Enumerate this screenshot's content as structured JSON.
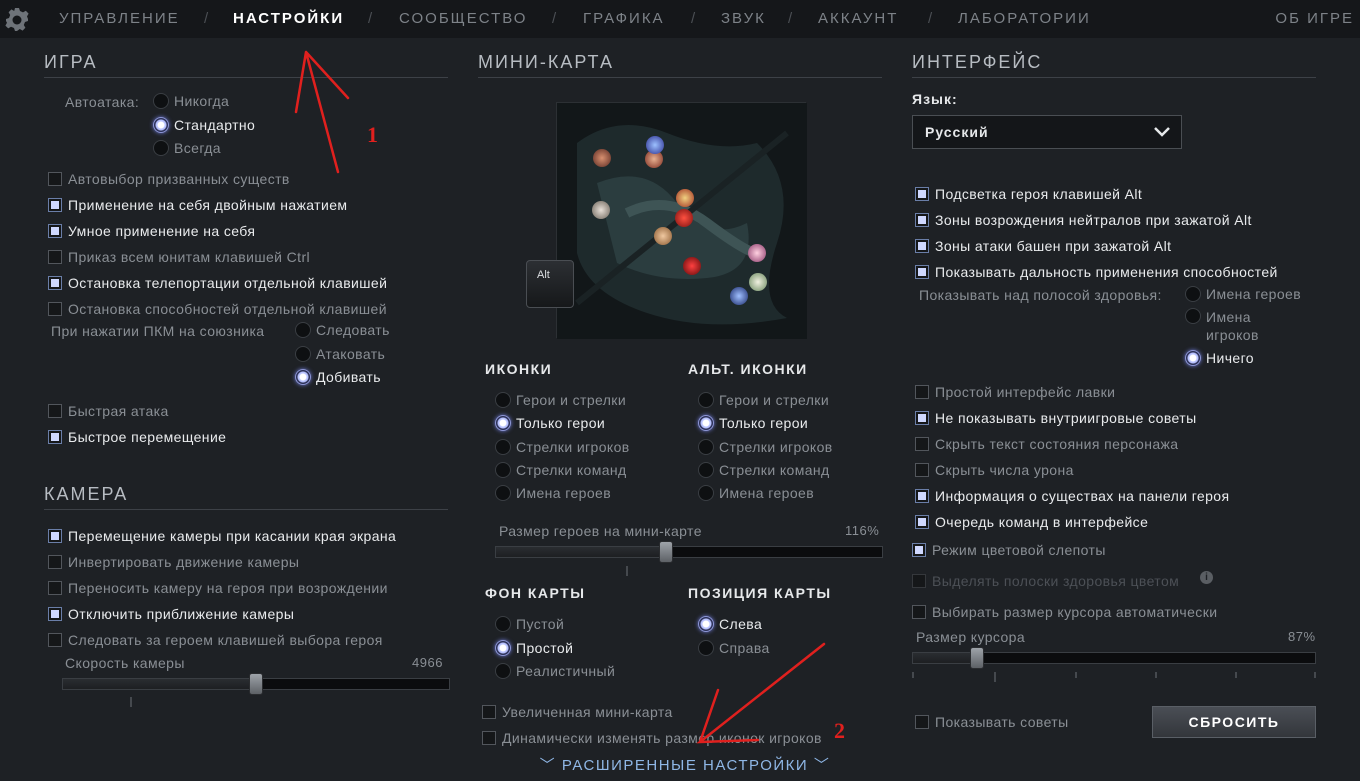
{
  "nav": {
    "items": [
      "УПРАВЛЕНИЕ",
      "НАСТРОЙКИ",
      "СООБЩЕСТВО",
      "ГРАФИКА",
      "ЗВУК",
      "АККАУНТ",
      "ЛАБОРАТОРИИ"
    ],
    "active": "НАСТРОЙКИ",
    "separator": "/",
    "about": "ОБ ИГРЕ"
  },
  "game": {
    "title": "ИГРА",
    "autoattack_label": "Автоатака:",
    "autoattack_options": [
      "Никогда",
      "Стандартно",
      "Всегда"
    ],
    "autoattack_selected": "Стандартно",
    "checkboxes": [
      {
        "label": "Автовыбор призванных существ",
        "checked": false
      },
      {
        "label": "Применение на себя двойным нажатием",
        "checked": true
      },
      {
        "label": "Умное применение на себя",
        "checked": true
      },
      {
        "label": "Приказ всем юнитам клавишей Ctrl",
        "checked": false
      },
      {
        "label": "Остановка телепортации отдельной клавишей",
        "checked": true
      },
      {
        "label": "Остановка способностей отдельной клавишей",
        "checked": false
      }
    ],
    "rmb_label": "При нажатии ПКМ на союзника",
    "rmb_options": [
      "Следовать",
      "Атаковать",
      "Добивать"
    ],
    "rmb_selected": "Добивать",
    "checkboxes2": [
      {
        "label": "Быстрая атака",
        "checked": false
      },
      {
        "label": "Быстрое перемещение",
        "checked": true
      }
    ]
  },
  "camera": {
    "title": "КАМЕРА",
    "checkboxes": [
      {
        "label": "Перемещение камеры при касании края экрана",
        "checked": true
      },
      {
        "label": "Инвертировать движение камеры",
        "checked": false
      },
      {
        "label": "Переносить камеру на героя при возрождении",
        "checked": false
      },
      {
        "label": "Отключить приближение камеры",
        "checked": true
      },
      {
        "label": "Следовать за героем клавишей выбора героя",
        "checked": false
      }
    ],
    "speed_label": "Скорость камеры",
    "speed_value": "4966",
    "speed_fraction": 0.5
  },
  "minimap": {
    "title": "МИНИ-КАРТА",
    "alt_key": "Alt",
    "icons_title": "ИКОНКИ",
    "icons_options": [
      "Герои и стрелки",
      "Только герои",
      "Стрелки игроков",
      "Стрелки команд",
      "Имена героев"
    ],
    "icons_selected": "Только герои",
    "alt_icons_title": "АЛЬТ. ИКОНКИ",
    "alt_icons_options": [
      "Герои и стрелки",
      "Только герои",
      "Стрелки игроков",
      "Стрелки команд",
      "Имена героев"
    ],
    "alt_icons_selected": "Только герои",
    "hero_size_label": "Размер героев на мини-карте",
    "hero_size_value": "116%",
    "hero_size_fraction": 0.44,
    "bg_title": "ФОН КАРТЫ",
    "bg_options": [
      "Пустой",
      "Простой",
      "Реалистичный"
    ],
    "bg_selected": "Простой",
    "pos_title": "ПОЗИЦИЯ КАРТЫ",
    "pos_options": [
      "Слева",
      "Справа"
    ],
    "pos_selected": "Слева",
    "checkboxes": [
      {
        "label": "Увеличенная мини-карта",
        "checked": false
      },
      {
        "label": "Динамически изменять размер иконок игроков",
        "checked": false
      }
    ],
    "advanced": "РАСШИРЕННЫЕ НАСТРОЙКИ"
  },
  "interface": {
    "title": "ИНТЕРФЕЙС",
    "lang_label": "Язык:",
    "lang_value": "Русский",
    "checkboxes": [
      {
        "label": "Подсветка героя клавишей Alt",
        "checked": true
      },
      {
        "label": "Зоны возрождения нейтралов при зажатой Alt",
        "checked": true
      },
      {
        "label": "Зоны атаки башен при зажатой Alt",
        "checked": true
      },
      {
        "label": "Показывать дальность применения способностей",
        "checked": true
      }
    ],
    "health_label": "Показывать над полосой здоровья:",
    "health_options": [
      "Имена героев",
      "Имена игроков",
      "Ничего"
    ],
    "health_selected": "Ничего",
    "checkboxes2": [
      {
        "label": "Простой интерфейс лавки",
        "checked": false
      },
      {
        "label": "Не показывать внутриигровые советы",
        "checked": true
      },
      {
        "label": "Скрыть текст состояния персонажа",
        "checked": false
      },
      {
        "label": "Скрыть числа урона",
        "checked": false
      },
      {
        "label": "Информация о существах на панели героя",
        "checked": true
      },
      {
        "label": "Очередь команд в интерфейсе",
        "checked": true
      },
      {
        "label": "Режим цветовой слепоты",
        "checked": true
      }
    ],
    "health_color_label": "Выделять полоски здоровья цветом",
    "cursor_auto_label": "Выбирать размер курсора автоматически",
    "cursor_size_label": "Размер курсора",
    "cursor_size_value": "87%",
    "cursor_size_fraction": 0.16,
    "tips_label": "Показывать советы",
    "reset": "СБРОСИТЬ"
  },
  "annotations": {
    "one": "1",
    "two": "2"
  },
  "colors": {
    "accent": "#cfd8ff",
    "annotation": "#e0201e",
    "link": "#8fb7e6"
  }
}
